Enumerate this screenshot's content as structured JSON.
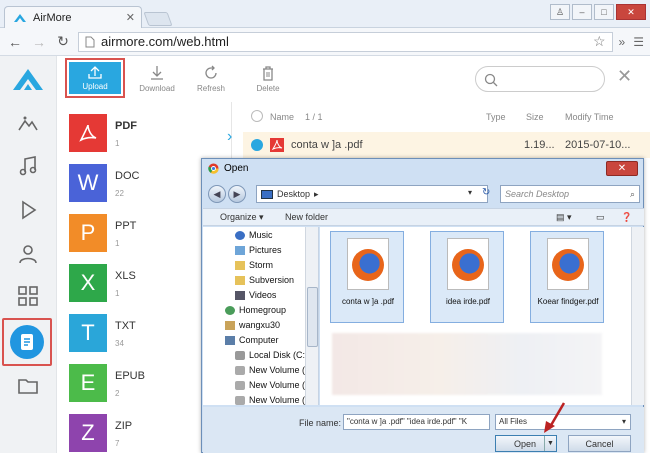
{
  "browser": {
    "tab_title": "AirMore",
    "url": "airmore.com/web.html"
  },
  "actions": {
    "upload": "Upload",
    "download": "Download",
    "refresh": "Refresh",
    "delete": "Delete"
  },
  "categories": [
    {
      "name": "PDF",
      "count": "1",
      "letter": "",
      "color": "#e53935"
    },
    {
      "name": "DOC",
      "count": "22",
      "letter": "W",
      "color": "#4a63d8"
    },
    {
      "name": "PPT",
      "count": "1",
      "letter": "P",
      "color": "#f28c28"
    },
    {
      "name": "XLS",
      "count": "1",
      "letter": "X",
      "color": "#2ea84a"
    },
    {
      "name": "TXT",
      "count": "34",
      "letter": "T",
      "color": "#2aa6d9"
    },
    {
      "name": "EPUB",
      "count": "2",
      "letter": "E",
      "color": "#4cbb4a"
    },
    {
      "name": "ZIP",
      "count": "7",
      "letter": "Z",
      "color": "#8e44ad"
    }
  ],
  "table": {
    "col_name": "Name",
    "count": "1 / 1",
    "col_type": "Type",
    "col_size": "Size",
    "col_modify": "Modify Time",
    "row": {
      "name": "conta w ]a .pdf",
      "size": "1.19...",
      "modified": "2015-07-10..."
    }
  },
  "dialog": {
    "title": "Open",
    "close": "✕",
    "location": "Desktop",
    "search_placeholder": "Search Desktop",
    "organize": "Organize ▾",
    "new_folder": "New folder",
    "tree": [
      "Music",
      "Pictures",
      "Storm",
      "Subversion",
      "Videos",
      "Homegroup",
      "wangxu30",
      "Computer",
      "Local Disk (C:)",
      "New Volume (I",
      "New Volume (I",
      "New Volume (I"
    ],
    "files": [
      "conta w ]a .pdf",
      "idea irde.pdf",
      "Koear findger.pdf"
    ],
    "file_name_label": "File name:",
    "file_name_value": "\"conta w ]a .pdf\" \"idea irde.pdf\" \"K",
    "file_type": "All Files",
    "open": "Open",
    "cancel": "Cancel"
  },
  "colors": {
    "accent": "#29a7e0",
    "highlight": "#d9534f"
  }
}
